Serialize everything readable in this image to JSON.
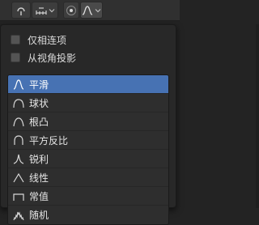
{
  "header": {
    "icons": [
      "snap-falloff-icon",
      "chevron-down-icon",
      "mirror-axes-icon",
      "chevron-down-icon",
      "proportional-edit-icon",
      "falloff-curve-icon",
      "chevron-down-icon"
    ]
  },
  "options": [
    {
      "label": "仅相连项",
      "checked": false
    },
    {
      "label": "从视角投影",
      "checked": false
    }
  ],
  "falloff": {
    "selected": "平滑",
    "items": [
      {
        "label": "平滑",
        "icon": "smooth-falloff-icon"
      },
      {
        "label": "球状",
        "icon": "sphere-falloff-icon"
      },
      {
        "label": "根凸",
        "icon": "root-falloff-icon"
      },
      {
        "label": "平方反比",
        "icon": "inverse-square-falloff-icon"
      },
      {
        "label": "锐利",
        "icon": "sharp-falloff-icon"
      },
      {
        "label": "线性",
        "icon": "linear-falloff-icon"
      },
      {
        "label": "常值",
        "icon": "constant-falloff-icon"
      },
      {
        "label": "随机",
        "icon": "random-falloff-icon"
      }
    ]
  },
  "colors": {
    "accent": "#4772b3",
    "background": "#282828"
  }
}
